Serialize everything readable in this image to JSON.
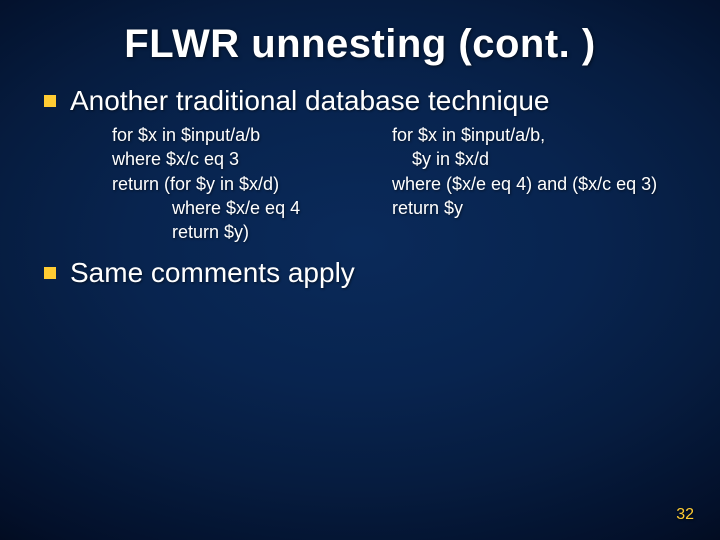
{
  "title": "FLWR unnesting (cont. )",
  "bullets": {
    "b1": "Another traditional database technique",
    "b2": "Same comments apply"
  },
  "code": {
    "left": "for $x in $input/a/b\nwhere $x/c eq 3\nreturn (for $y in $x/d)\n            where $x/e eq 4\n            return $y)",
    "right": "for $x in $input/a/b,\n    $y in $x/d\nwhere ($x/e eq 4) and ($x/c eq 3)\nreturn $y"
  },
  "page_number": "32"
}
